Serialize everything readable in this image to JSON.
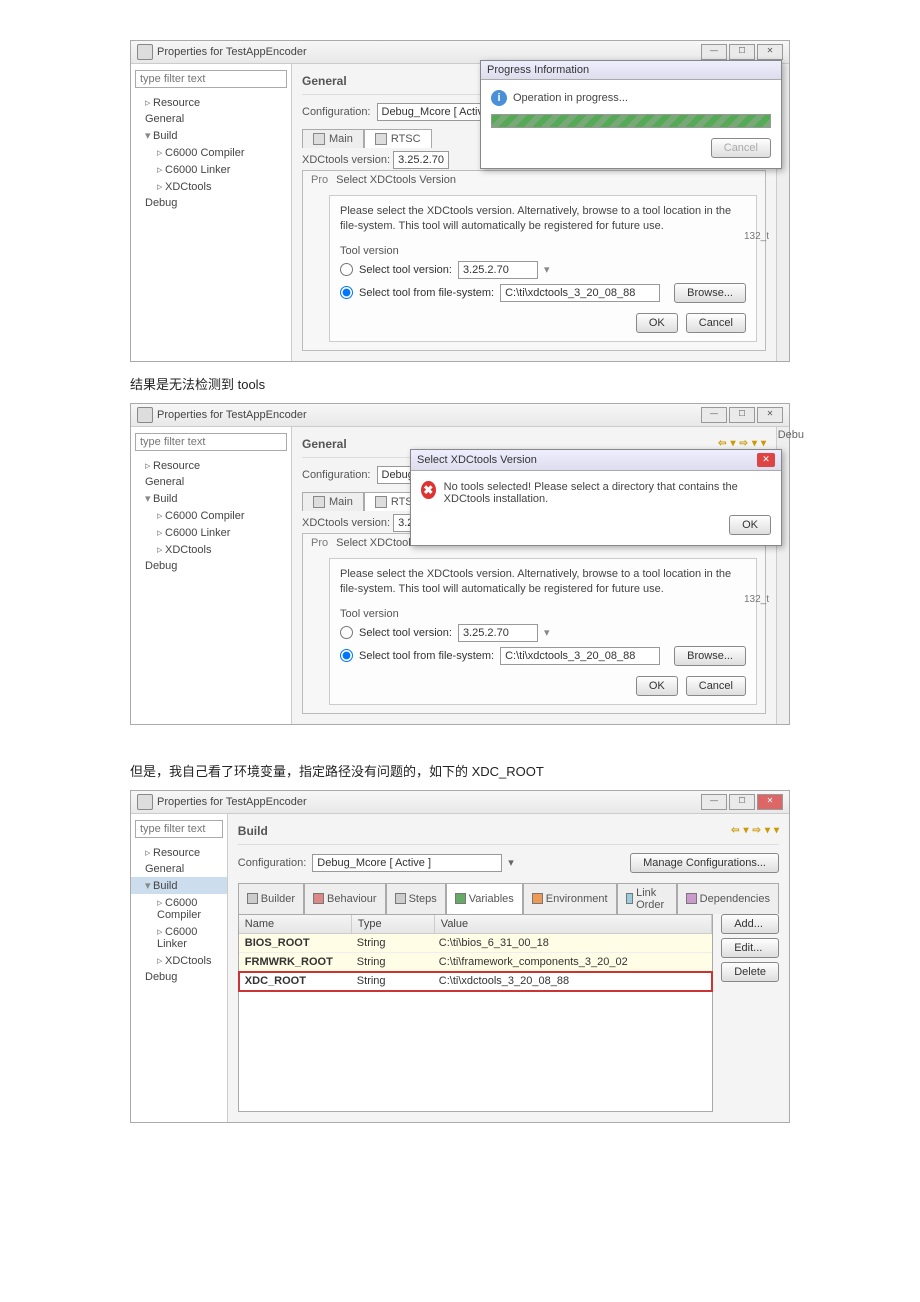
{
  "win_title": "Properties for TestAppEncoder",
  "filter_placeholder": "type filter text",
  "tree": {
    "resource": "Resource",
    "general": "General",
    "build": "Build",
    "c6000c": "C6000 Compiler",
    "c6000l": "C6000 Linker",
    "xdc": "XDCtools",
    "debug": "Debug"
  },
  "heading_general": "General",
  "heading_build": "Build",
  "config_label": "Configuration:",
  "config_value": "Debug_Mcore  [ Active ]",
  "tab_main": "Main",
  "tab_rtsc": "RTSC",
  "xdc_ver_label": "XDCtools version:",
  "xdc_ver": "3.25.2.70",
  "select_dlg_title": "Select XDCtools Version",
  "pro_prefix": "Pro",
  "select_dlg_text": "Please select the XDCtools version. Alternatively, browse to a tool location in the file-system. This tool will automatically be registered for future use.",
  "toolver_legend": "Tool version",
  "radio1_label": "Select tool version:",
  "radio1_value": "3.25.2.70",
  "radio2_label": "Select tool from file-system:",
  "radio2_value": "C:\\ti\\xdctools_3_20_08_88",
  "browse": "Browse...",
  "ok": "OK",
  "cancel": "Cancel",
  "progress_title": "Progress Information",
  "progress_text": "Operation in progress...",
  "small32": "132_t",
  "err_dlg_title": "Select XDCtools Version",
  "err_text": "No tools selected! Please select a directory that contains the XDCtools installation.",
  "caption1": "结果是无法检测到 tools",
  "caption2": "但是，我自己看了环境变量，指定路径没有问题的，如下的 XDC_ROOT",
  "manage_conf": "Manage Configurations...",
  "vtabs": {
    "builder": "Builder",
    "behaviour": "Behaviour",
    "steps": "Steps",
    "variables": "Variables",
    "env": "Environment",
    "link": "Link Order",
    "deps": "Dependencies"
  },
  "vhdr": {
    "name": "Name",
    "type": "Type",
    "value": "Value"
  },
  "vrows": [
    {
      "n": "BIOS_ROOT",
      "t": "String",
      "v": "C:\\ti\\bios_6_31_00_18"
    },
    {
      "n": "FRMWRK_ROOT",
      "t": "String",
      "v": "C:\\ti\\framework_components_3_20_02"
    },
    {
      "n": "XDC_ROOT",
      "t": "String",
      "v": "C:\\ti\\xdctools_3_20_08_88"
    }
  ],
  "sidebtns": {
    "add": "Add...",
    "edit": "Edit...",
    "del": "Delete"
  },
  "debu": "Debu"
}
